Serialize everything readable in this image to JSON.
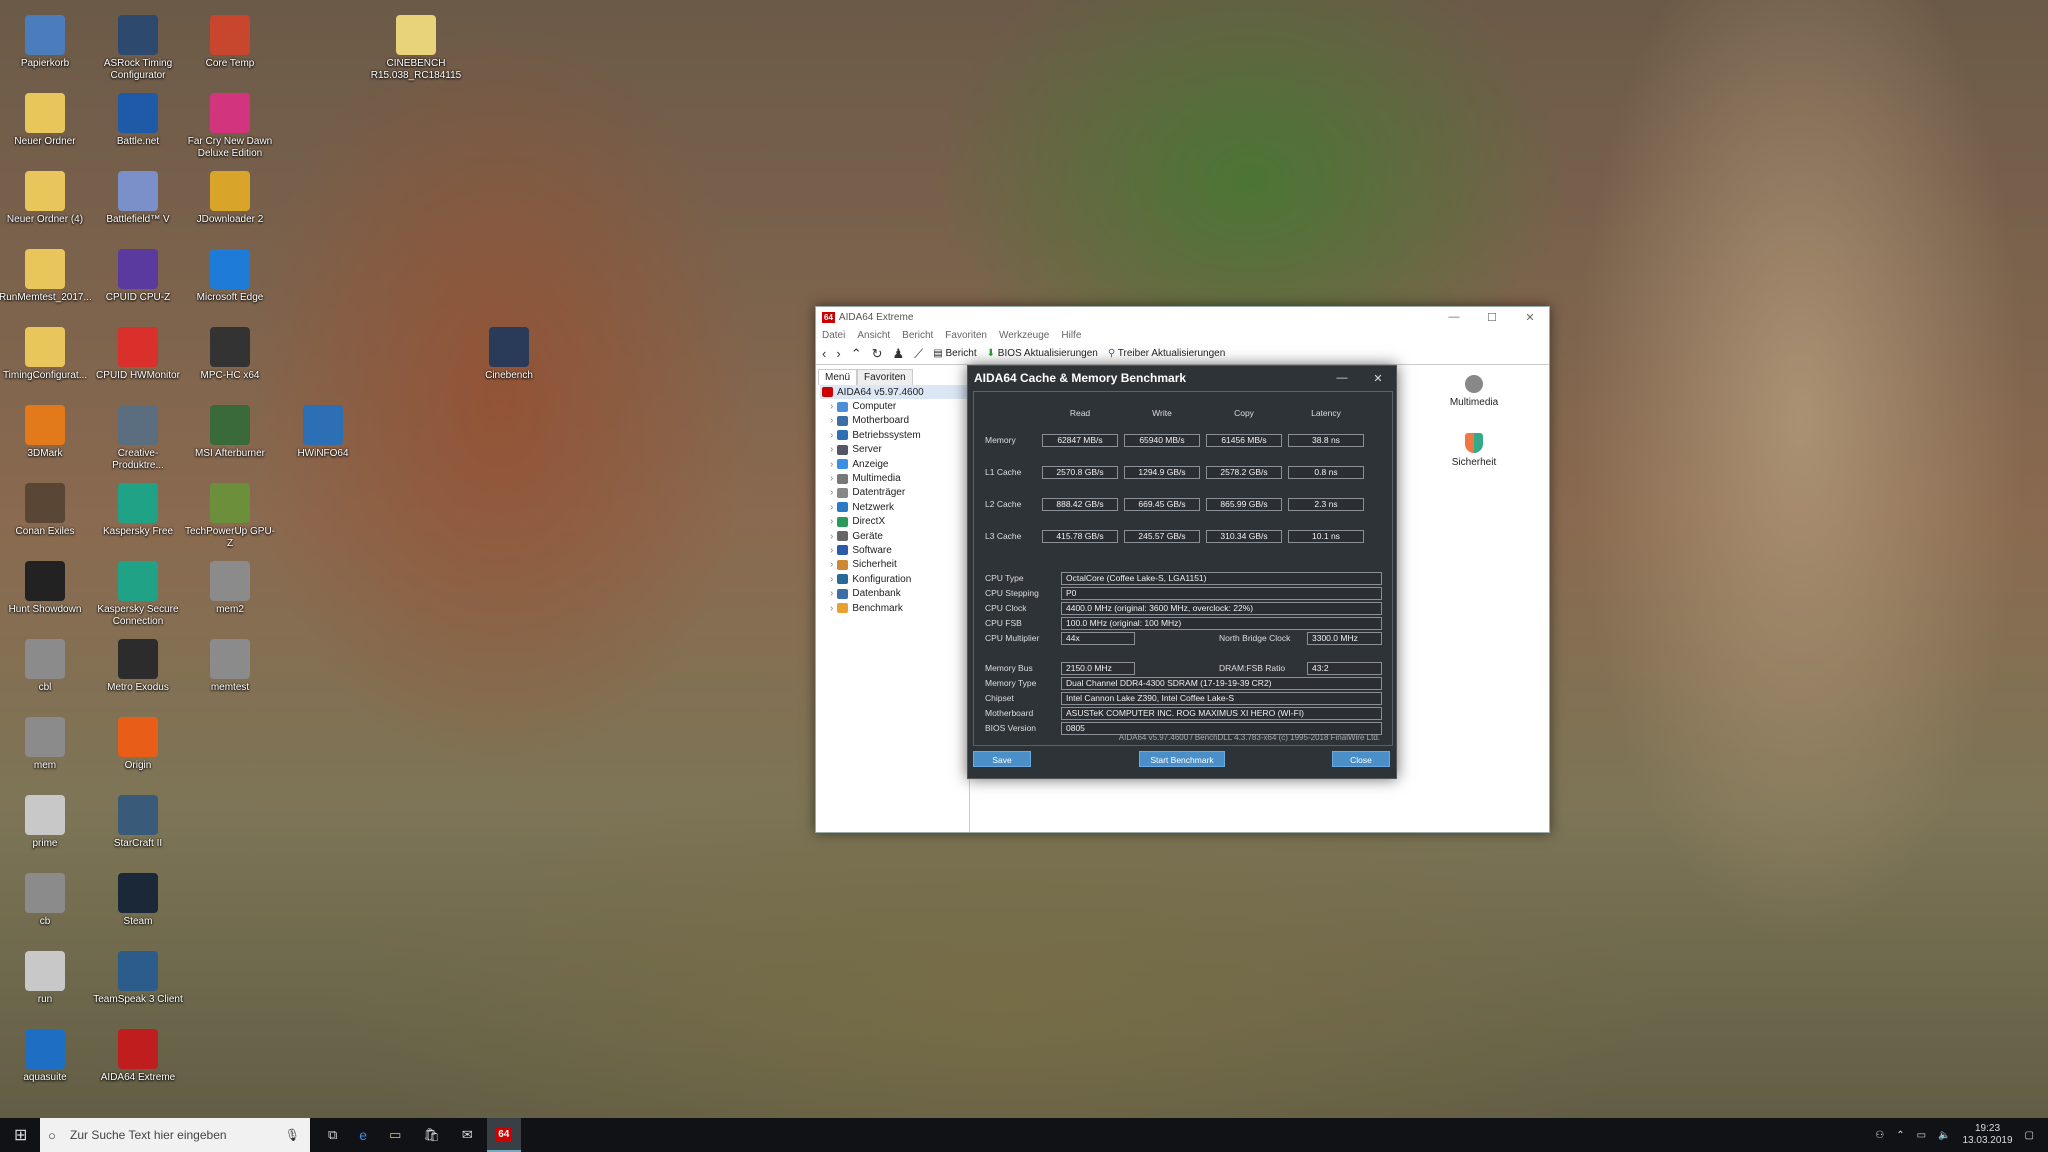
{
  "desktop_icons": [
    {
      "label": "Papierkorb",
      "color": "#4b7dbc"
    },
    {
      "label": "ASRock Timing Configurator",
      "color": "#2d4a6e"
    },
    {
      "label": "Core Temp",
      "color": "#c8452e"
    },
    {
      "label": "CINEBENCH R15.038_RC184115",
      "color": "#e8d37a"
    },
    {
      "label": "Neuer Ordner",
      "color": "#e8c65c"
    },
    {
      "label": "Battle.net",
      "color": "#1f5aa8"
    },
    {
      "label": "Far Cry New Dawn Deluxe Edition",
      "color": "#d2357d"
    },
    {
      "label": "Neuer Ordner (4)",
      "color": "#e8c65c"
    },
    {
      "label": "Battlefield™ V",
      "color": "#7b8fc9"
    },
    {
      "label": "JDownloader 2",
      "color": "#d8a52a"
    },
    {
      "label": "RunMemtest_2017...",
      "color": "#e8c65c"
    },
    {
      "label": "CPUID CPU-Z",
      "color": "#5b3aa0"
    },
    {
      "label": "Microsoft Edge",
      "color": "#1e7bd8"
    },
    {
      "label": "TimingConfigurat...",
      "color": "#e8c65c"
    },
    {
      "label": "CPUID HWMonitor",
      "color": "#d9302c"
    },
    {
      "label": "MPC-HC x64",
      "color": "#333333"
    },
    {
      "label": "Cinebench",
      "color": "#2a3b5a"
    },
    {
      "label": "3DMark",
      "color": "#e27a1b"
    },
    {
      "label": "Creative-Produktre...",
      "color": "#5a6e80"
    },
    {
      "label": "MSI Afterburner",
      "color": "#3a6a3a"
    },
    {
      "label": "HWiNFO64",
      "color": "#2d6fb5"
    },
    {
      "label": "Conan Exiles",
      "color": "#5a4634"
    },
    {
      "label": "Kaspersky Free",
      "color": "#1fa286"
    },
    {
      "label": "TechPowerUp GPU-Z",
      "color": "#6b8f3a"
    },
    {
      "label": "Hunt Showdown",
      "color": "#222222"
    },
    {
      "label": "Kaspersky Secure Connection",
      "color": "#1fa286"
    },
    {
      "label": "mem2",
      "color": "#8b8b8b"
    },
    {
      "label": "cbl",
      "color": "#8b8b8b"
    },
    {
      "label": "Metro Exodus",
      "color": "#2c2c2c"
    },
    {
      "label": "memtest",
      "color": "#8b8b8b"
    },
    {
      "label": "mem",
      "color": "#8b8b8b"
    },
    {
      "label": "Origin",
      "color": "#e85d18"
    },
    {
      "label": "prime",
      "color": "#c8c8c8"
    },
    {
      "label": "StarCraft II",
      "color": "#3a5a7a"
    },
    {
      "label": "cb",
      "color": "#8b8b8b"
    },
    {
      "label": "Steam",
      "color": "#1b2838"
    },
    {
      "label": "run",
      "color": "#c8c8c8"
    },
    {
      "label": "TeamSpeak 3 Client",
      "color": "#2b5c8a"
    },
    {
      "label": "aquasuite",
      "color": "#1e6fc4"
    },
    {
      "label": "AIDA64 Extreme",
      "color": "#c01e1e"
    }
  ],
  "aida": {
    "title": "AIDA64 Extreme",
    "badge": "64",
    "menu": [
      "Datei",
      "Ansicht",
      "Bericht",
      "Favoriten",
      "Werkzeuge",
      "Hilfe"
    ],
    "toolbar": {
      "report": "Bericht",
      "bios": "BIOS Aktualisierungen",
      "driver": "Treiber Aktualisierungen"
    },
    "tabs": [
      "Menü",
      "Favoriten"
    ],
    "tree": [
      "AIDA64 v5.97.4600",
      "Computer",
      "Motherboard",
      "Betriebssystem",
      "Server",
      "Anzeige",
      "Multimedia",
      "Datenträger",
      "Netzwerk",
      "DirectX",
      "Geräte",
      "Software",
      "Sicherheit",
      "Konfiguration",
      "Datenbank",
      "Benchmark"
    ],
    "right_items": [
      "Multimedia",
      "Sicherheit"
    ]
  },
  "bench": {
    "title": "AIDA64 Cache & Memory Benchmark",
    "headers": [
      "Read",
      "Write",
      "Copy",
      "Latency"
    ],
    "rows": [
      {
        "label": "Memory",
        "values": [
          "62847 MB/s",
          "65940 MB/s",
          "61456 MB/s",
          "38.8 ns"
        ]
      },
      {
        "label": "L1 Cache",
        "values": [
          "2570.8 GB/s",
          "1294.9 GB/s",
          "2578.2 GB/s",
          "0.8 ns"
        ]
      },
      {
        "label": "L2 Cache",
        "values": [
          "888.42 GB/s",
          "669.45 GB/s",
          "865.99 GB/s",
          "2.3 ns"
        ]
      },
      {
        "label": "L3 Cache",
        "values": [
          "415.78 GB/s",
          "245.57 GB/s",
          "310.34 GB/s",
          "10.1 ns"
        ]
      }
    ],
    "cpu_type_label": "CPU Type",
    "cpu_type": "OctalCore  (Coffee Lake-S, LGA1151)",
    "cpu_stepping_label": "CPU Stepping",
    "cpu_stepping": "P0",
    "cpu_clock_label": "CPU Clock",
    "cpu_clock": "4400.0 MHz  (original: 3600 MHz, overclock: 22%)",
    "cpu_fsb_label": "CPU FSB",
    "cpu_fsb": "100.0 MHz  (original: 100 MHz)",
    "cpu_mult_label": "CPU Multiplier",
    "cpu_mult": "44x",
    "nb_clock_label": "North Bridge Clock",
    "nb_clock": "3300.0 MHz",
    "mem_bus_label": "Memory Bus",
    "mem_bus": "2150.0 MHz",
    "dram_ratio_label": "DRAM:FSB Ratio",
    "dram_ratio": "43:2",
    "mem_type_label": "Memory Type",
    "mem_type": "Dual Channel DDR4-4300 SDRAM  (17-19-19-39 CR2)",
    "chipset_label": "Chipset",
    "chipset": "Intel Cannon Lake Z390, Intel Coffee Lake-S",
    "mobo_label": "Motherboard",
    "mobo": "ASUSTeK COMPUTER INC. ROG MAXIMUS XI HERO (WI-FI)",
    "bios_label": "BIOS Version",
    "bios": "0805",
    "footer": "AIDA64 v5.97.4600 / BenchDLL 4.3.783-x64  (c) 1995-2018 FinalWire Ltd.",
    "buttons": {
      "save": "Save",
      "start": "Start Benchmark",
      "close": "Close"
    }
  },
  "taskbar": {
    "search_placeholder": "Zur Suche Text hier eingeben",
    "time": "19:23",
    "date": "13.03.2019",
    "active_app": "64"
  }
}
